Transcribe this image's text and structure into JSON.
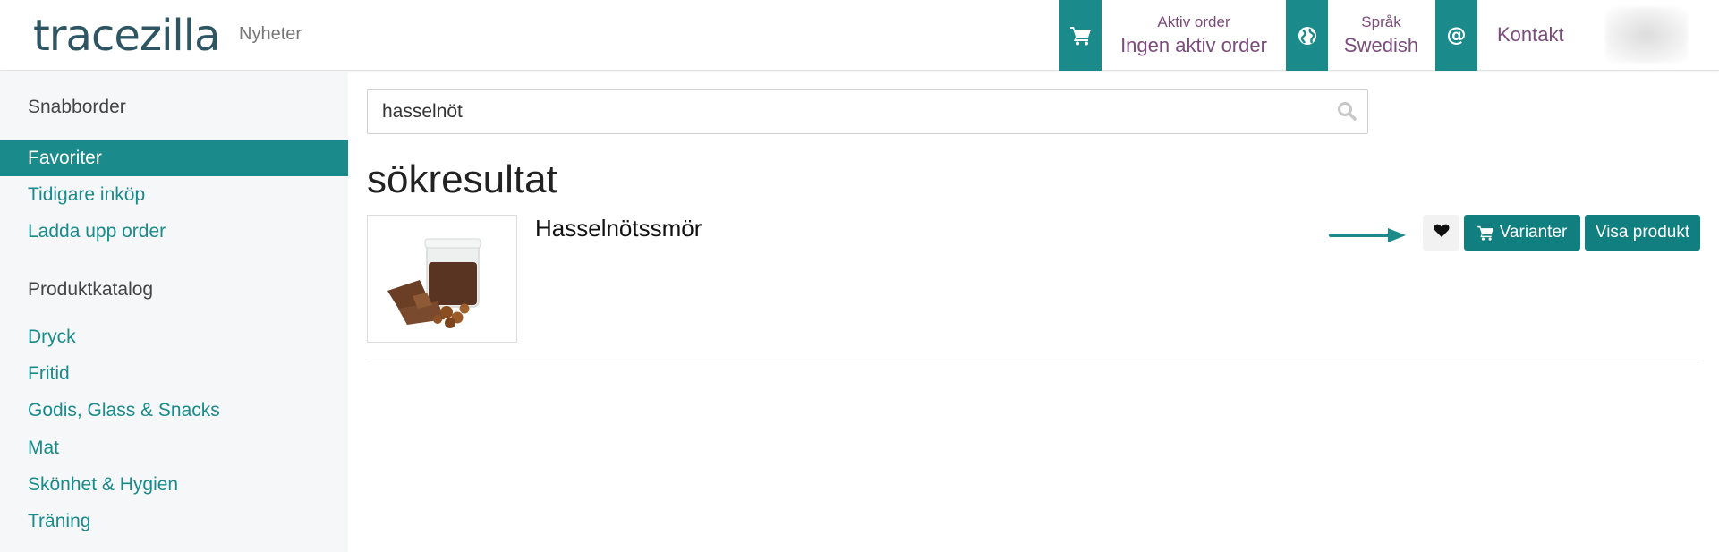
{
  "header": {
    "logo": "tracezilla",
    "news_label": "Nyheter",
    "active_order": {
      "label": "Aktiv order",
      "value": "Ingen aktiv order",
      "icon": "cart-icon"
    },
    "language": {
      "label": "Språk",
      "value": "Swedish",
      "icon": "globe-icon"
    },
    "contact": {
      "label": "Kontakt",
      "icon": "at-icon"
    }
  },
  "sidebar": {
    "quick_order_heading": "Snabborder",
    "quick_items": [
      {
        "label": "Favoriter",
        "active": true
      },
      {
        "label": "Tidigare inköp",
        "active": false
      },
      {
        "label": "Ladda upp order",
        "active": false
      }
    ],
    "catalog_heading": "Produktkatalog",
    "catalog_items": [
      {
        "label": "Dryck"
      },
      {
        "label": "Fritid"
      },
      {
        "label": "Godis, Glass & Snacks"
      },
      {
        "label": "Mat"
      },
      {
        "label": "Skönhet & Hygien"
      },
      {
        "label": "Träning"
      }
    ]
  },
  "search": {
    "value": "hasselnöt",
    "icon": "search-icon"
  },
  "results": {
    "title": "sökresultat",
    "items": [
      {
        "name": "Hasselnötssmör",
        "favorite_icon": "heart-icon",
        "variants_label": "Varianter",
        "view_label": "Visa produkt"
      }
    ]
  },
  "colors": {
    "accent": "#1a8a8a",
    "button": "#117f7f",
    "header_text": "#7b4b7b",
    "sidebar_bg": "#f6f7f9"
  }
}
